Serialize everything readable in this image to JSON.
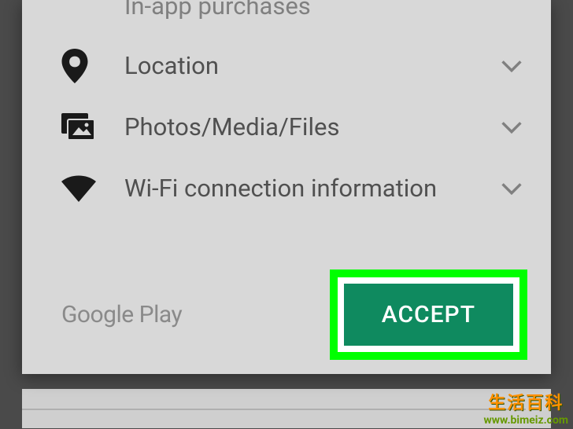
{
  "permissions": {
    "items": [
      {
        "label": "In-app purchases",
        "icon": "plus-icon",
        "expandable": false,
        "truncated": true
      },
      {
        "label": "Location",
        "icon": "location-pin-icon",
        "expandable": true
      },
      {
        "label": "Photos/Media/Files",
        "icon": "media-folder-icon",
        "expandable": true
      },
      {
        "label": "Wi-Fi connection information",
        "icon": "wifi-icon",
        "expandable": true
      }
    ]
  },
  "footer": {
    "brand": "Google Play",
    "accept_label": "ACCEPT"
  },
  "watermark": {
    "title": "生活百科",
    "url": "www.bimeiz.com"
  },
  "colors": {
    "dialog_bg": "#d8d8d8",
    "text": "#505050",
    "muted": "#8a8a8a",
    "accept_bg": "#0f8a5f",
    "highlight": "#00ff00"
  }
}
